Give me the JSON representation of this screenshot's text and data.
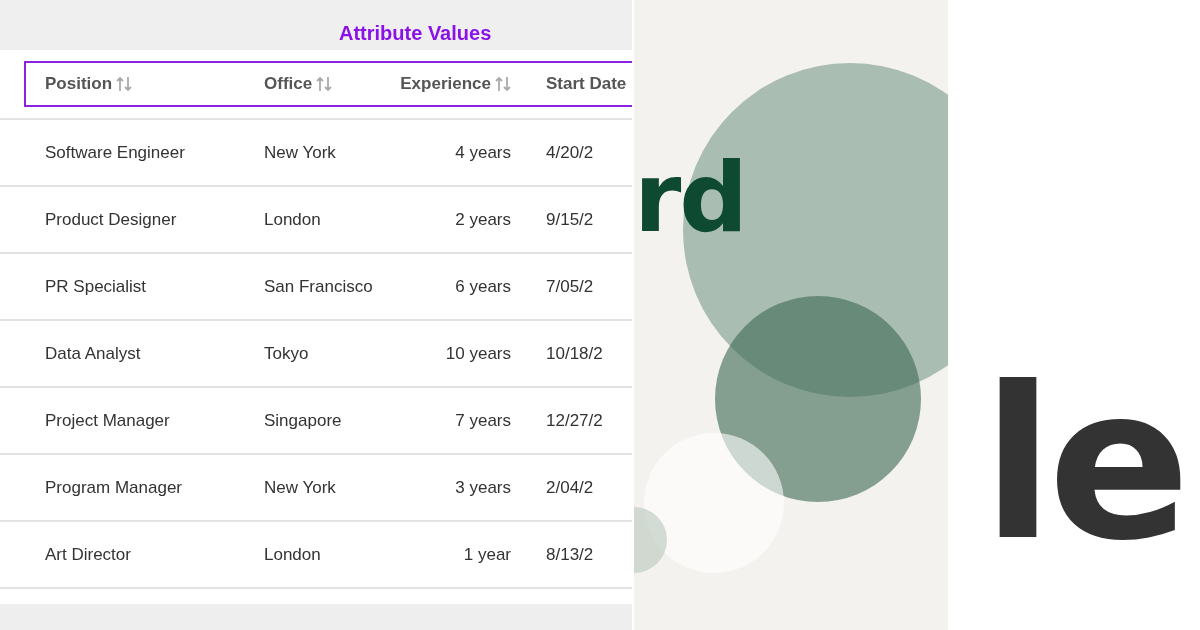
{
  "table_panel": {
    "title": "Attribute Values",
    "columns": [
      {
        "label": "Position",
        "sortable": true
      },
      {
        "label": "Office",
        "sortable": true
      },
      {
        "label": "Experience",
        "sortable": true
      },
      {
        "label": "Start Date",
        "sortable": false
      }
    ],
    "rows": [
      [
        "Software Engineer",
        "New York",
        "4 years",
        "4/20/2"
      ],
      [
        "Product Designer",
        "London",
        "2 years",
        "9/15/2"
      ],
      [
        "PR Specialist",
        "San Francisco",
        "6 years",
        "7/05/2"
      ],
      [
        "Data Analyst",
        "Tokyo",
        "10 years",
        "10/18/2"
      ],
      [
        "Project Manager",
        "Singapore",
        "7 years",
        "12/27/2"
      ],
      [
        "Program Manager",
        "New York",
        "3 years",
        "2/04/2"
      ],
      [
        "Art Director",
        "London",
        "1 year",
        "8/13/2"
      ]
    ]
  },
  "graphic_panel": {
    "text": "rd"
  },
  "logo_panel": {
    "text": "le"
  }
}
